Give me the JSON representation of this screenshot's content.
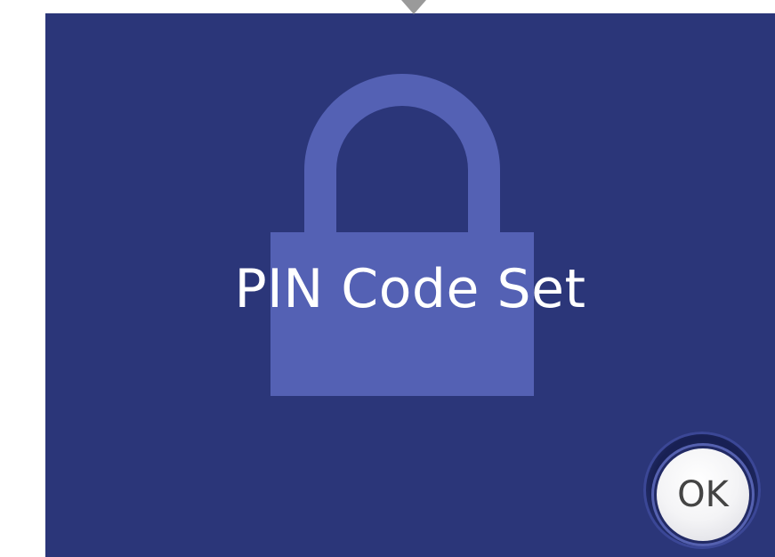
{
  "screen": {
    "message": "PIN Code Set",
    "icon": "lock-icon",
    "background_color": "#2b3679",
    "icon_color": "#5461b4"
  },
  "ok_button": {
    "label": "OK"
  }
}
